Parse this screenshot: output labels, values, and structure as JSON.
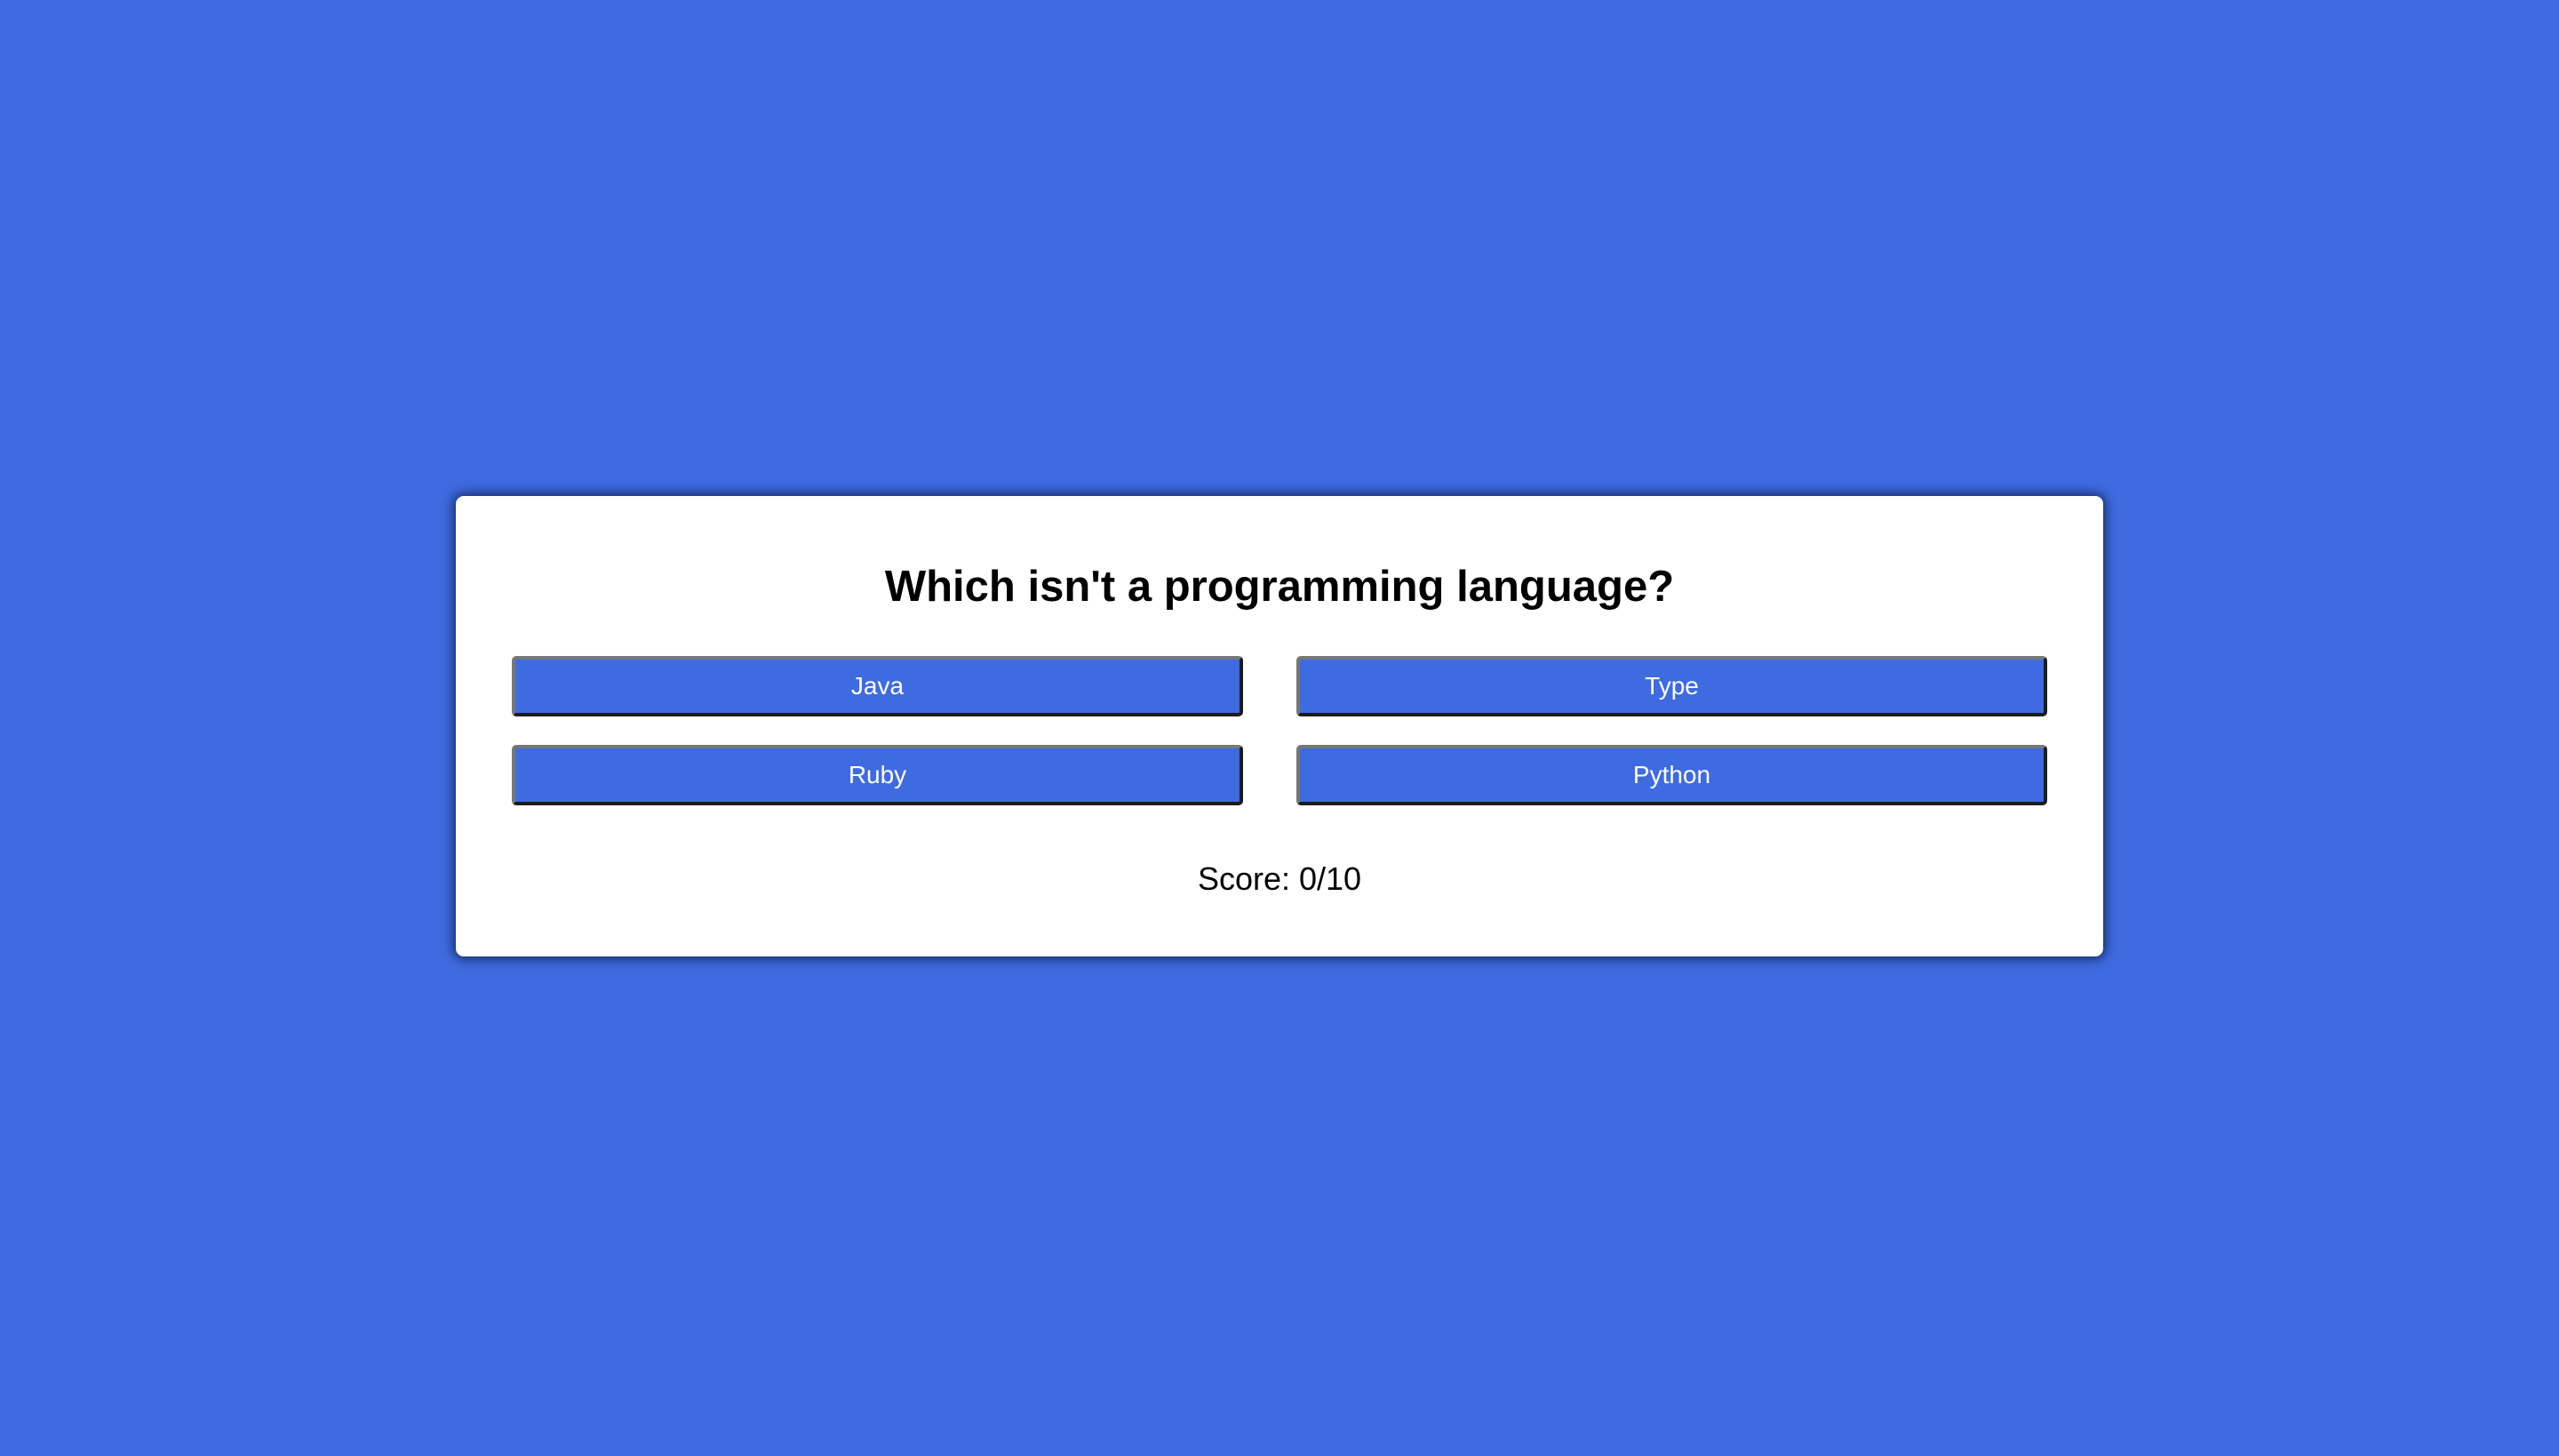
{
  "colors": {
    "background": "#3f6be0",
    "card": "#ffffff",
    "button": "#3f6be0",
    "button_text": "#ffffff",
    "text": "#000000"
  },
  "quiz": {
    "question": "Which isn't a programming language?",
    "answers": [
      {
        "label": "Java"
      },
      {
        "label": "Type"
      },
      {
        "label": "Ruby"
      },
      {
        "label": "Python"
      }
    ],
    "score_text": "Score: 0/10"
  }
}
